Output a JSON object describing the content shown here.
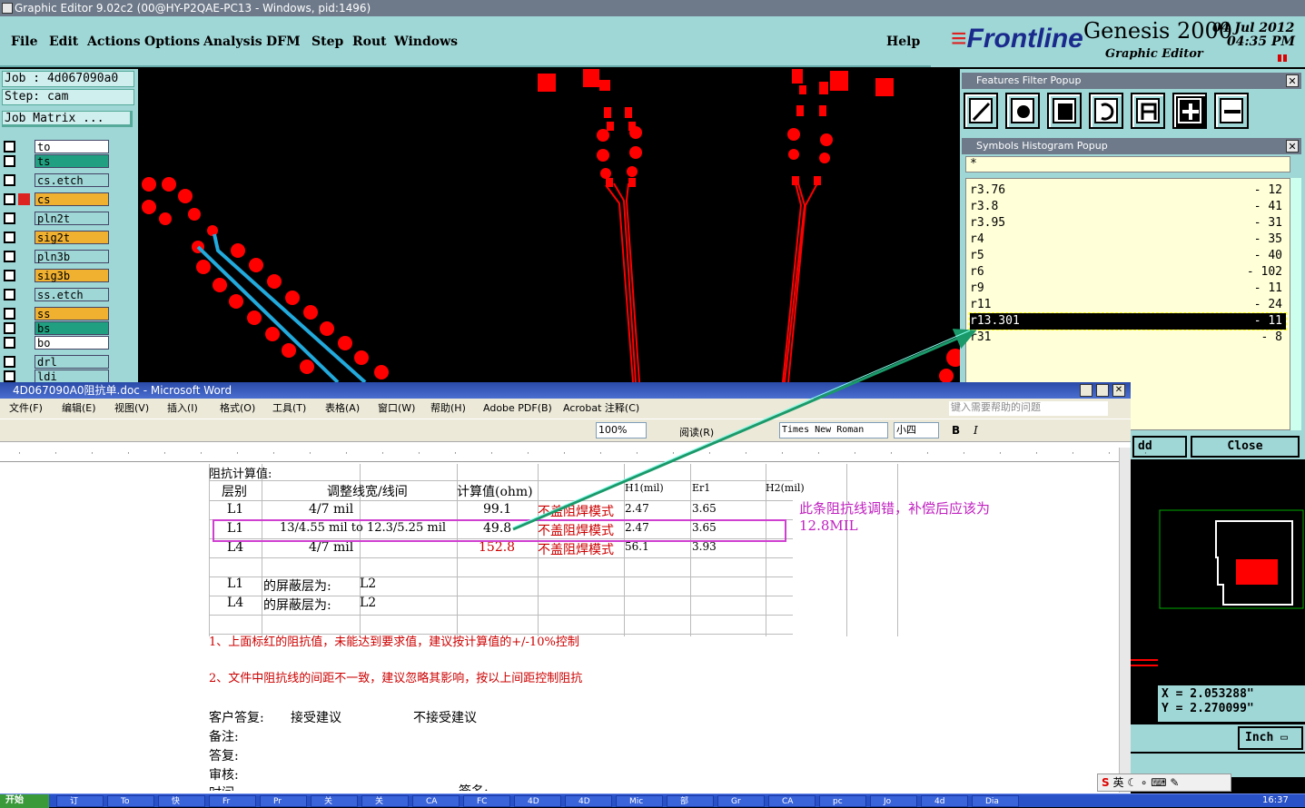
{
  "app": {
    "title": "Graphic Editor 9.02c2 (00@HY-P2QAE-PC13 - Windows, pid:1496)"
  },
  "menu": {
    "items": [
      "File",
      "Edit",
      "Actions",
      "Options",
      "Analysis",
      "DFM",
      "Step",
      "Rout",
      "Windows"
    ],
    "help": "Help"
  },
  "brand": {
    "logo": "Frontline",
    "product": "Genesis 2000",
    "subtitle": "Graphic Editor",
    "date": "04 Jul 2012",
    "time": "04:35 PM"
  },
  "job": {
    "job": "Job : 4d067090a0",
    "step": "Step: cam",
    "matrix": "Job Matrix ..."
  },
  "layers": [
    {
      "name": "to",
      "color": "#ffffff"
    },
    {
      "name": "ts",
      "color": "#20a080"
    },
    {
      "name": "cs.etch",
      "color": "#9fd6d6"
    },
    {
      "name": "cs",
      "color": "#f0b030"
    },
    {
      "name": "pln2t",
      "color": "#9fd6d6"
    },
    {
      "name": "sig2t",
      "color": "#f0b030"
    },
    {
      "name": "pln3b",
      "color": "#9fd6d6"
    },
    {
      "name": "sig3b",
      "color": "#f0b030"
    },
    {
      "name": "ss.etch",
      "color": "#9fd6d6"
    },
    {
      "name": "ss",
      "color": "#f0b030"
    },
    {
      "name": "bs",
      "color": "#20a080"
    },
    {
      "name": "bo",
      "color": "#ffffff"
    },
    {
      "name": "drl",
      "color": "#9fd6d6"
    },
    {
      "name": "ldi",
      "color": "#9fd6d6"
    }
  ],
  "filter_popup": {
    "title": "Features Filter Popup"
  },
  "histogram": {
    "title": "Symbols Histogram Popup",
    "filter": "*",
    "rows": [
      {
        "sym": "r3.76",
        "count": "- 12"
      },
      {
        "sym": "r3.8",
        "count": "- 41"
      },
      {
        "sym": "r3.95",
        "count": "- 31"
      },
      {
        "sym": "r4",
        "count": "- 35"
      },
      {
        "sym": "r5",
        "count": "- 40"
      },
      {
        "sym": "r6",
        "count": "- 102"
      },
      {
        "sym": "r9",
        "count": "- 11"
      },
      {
        "sym": "r11",
        "count": "- 24"
      },
      {
        "sym": "r13.301",
        "count": "- 11",
        "selected": true
      },
      {
        "sym": "r31",
        "count": "- 8"
      }
    ],
    "add_label": "dd",
    "close_label": "Close"
  },
  "coords": {
    "x": "X = 2.053288\"",
    "y": "Y = 2.270099\"",
    "unit": "Inch"
  },
  "word": {
    "title": "4D067090A0阻抗单.doc - Microsoft Word",
    "menu": [
      "文件(F)",
      "编辑(E)",
      "视图(V)",
      "插入(I)",
      "格式(O)",
      "工具(T)",
      "表格(A)",
      "窗口(W)",
      "帮助(H)",
      "Adobe PDF(B)",
      "Acrobat 注释(C)"
    ],
    "help_placeholder": "键入需要帮助的问题",
    "zoom": "100%",
    "read_label": "阅读(R)",
    "font": "Times New Roman",
    "size": "小四",
    "bold": "B",
    "italic": "I",
    "table": {
      "section_title": "阻抗计算值:",
      "headers": [
        "层别",
        "调整线宽/线间",
        "计算值(ohm)",
        "",
        "H1(mil)",
        "Er1",
        "H2(mil)"
      ],
      "rows": [
        [
          "L1",
          "4/7 mil",
          "99.1",
          "不盖阻焊模式",
          "2.47",
          "3.65"
        ],
        [
          "L1",
          "13/4.55 mil to 12.3/5.25 mil",
          "49.8",
          "不盖阻焊模式",
          "2.47",
          "3.65"
        ],
        [
          "L4",
          "4/7 mil",
          "152.8",
          "不盖阻焊模式",
          "56.1",
          "3.93"
        ]
      ],
      "shield": [
        [
          "L1",
          "的屏蔽层为:",
          "L2"
        ],
        [
          "L4",
          "的屏蔽层为:",
          "L2"
        ]
      ],
      "note1": "1、上面标红的阻抗值，未能达到要求值，建议按计算值的+/-10%控制",
      "note2": "2、文件中阻抗线的间距不一致，建议忽略其影响，按以上间距控制阻抗",
      "customer": "客户答复:",
      "accept": "接受建议",
      "reject": "不接受建议",
      "remark": "备注:",
      "reply": "答复:",
      "audit": "审核:",
      "time": "时间:",
      "sign": "签名:"
    },
    "annotation": "此条阻抗线调错，补偿后应该为12.8MIL"
  },
  "taskbar": {
    "start": "开始",
    "items": [
      "订",
      "To",
      "快",
      "Fr",
      "Pr",
      "关",
      "关",
      "CA",
      "FC",
      "4D",
      "4D",
      "Mic",
      "部",
      "Gr",
      "CA",
      "pc",
      "Jo",
      "4d",
      "Dia"
    ],
    "clock": "16:37",
    "ime": "英"
  }
}
